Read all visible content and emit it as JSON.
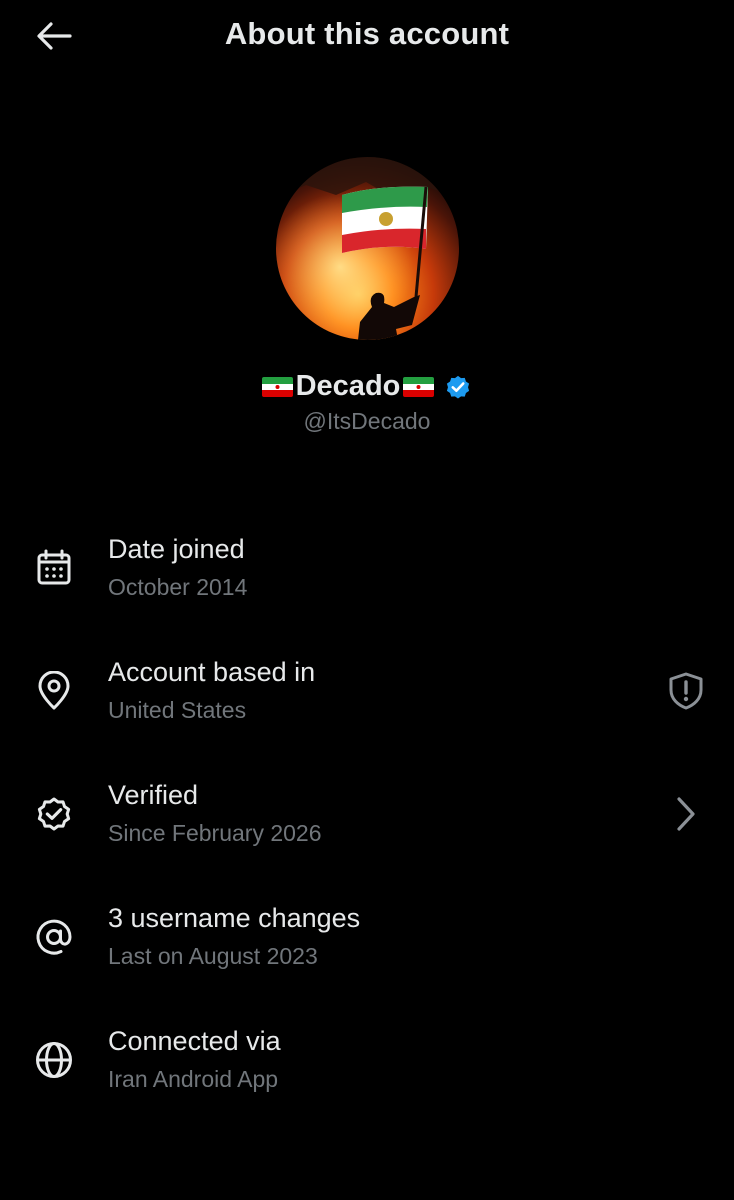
{
  "header": {
    "title": "About this account",
    "back_icon": "arrow-left-icon"
  },
  "profile": {
    "display_name": "Decado",
    "handle": "@ItsDecado",
    "verified": true,
    "badge_color": "#1d9bf0"
  },
  "rows": [
    {
      "icon": "calendar-icon",
      "title": "Date joined",
      "subtitle": "October 2014"
    },
    {
      "icon": "location-pin-icon",
      "title": "Account based in",
      "subtitle": "United States",
      "right_icon": "shield-alert-icon"
    },
    {
      "icon": "verified-check-icon",
      "title": "Verified",
      "subtitle": "Since February 2026",
      "right_icon": "chevron-right-icon"
    },
    {
      "icon": "at-sign-icon",
      "title": "3 username changes",
      "subtitle": "Last on August 2023"
    },
    {
      "icon": "globe-icon",
      "title": "Connected via",
      "subtitle": "Iran Android App"
    }
  ],
  "colors": {
    "background": "#000000",
    "primary_text": "#e7e9ea",
    "secondary_text": "#71767b"
  }
}
